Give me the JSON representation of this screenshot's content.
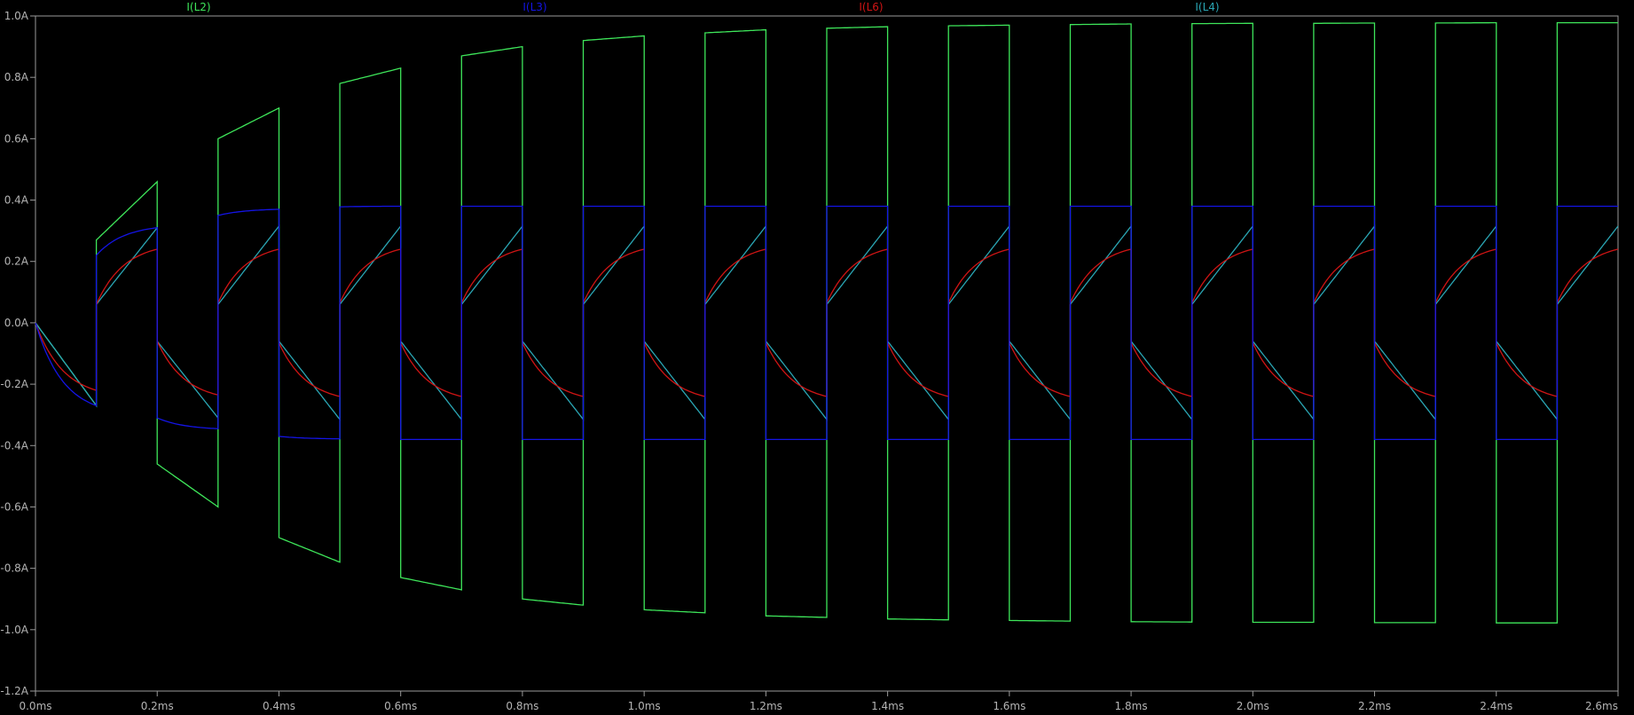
{
  "chart_data": {
    "type": "line",
    "title": "",
    "xlabel": "",
    "ylabel": "",
    "x_unit": "ms",
    "y_unit": "A",
    "xlim": [
      0.0,
      2.6
    ],
    "ylim": [
      -1.2,
      1.0
    ],
    "x_ticks": [
      "0.0ms",
      "0.2ms",
      "0.4ms",
      "0.6ms",
      "0.8ms",
      "1.0ms",
      "1.2ms",
      "1.4ms",
      "1.6ms",
      "1.8ms",
      "2.0ms",
      "2.2ms",
      "2.4ms",
      "2.6ms"
    ],
    "y_ticks": [
      "1.0A",
      "0.8A",
      "0.6A",
      "0.4A",
      "0.2A",
      "0.0A",
      "-0.2A",
      "-0.4A",
      "-0.6A",
      "-0.8A",
      "-1.0A",
      "-1.2A"
    ],
    "grid": false,
    "legend_position": "top",
    "half_period_ms": 0.1,
    "series": [
      {
        "name": "I(L2)",
        "color": "#3ee65a",
        "shape": "square-wave-with-linear-ramps",
        "segments": [
          {
            "t": [
              0.0,
              0.1
            ],
            "start": 0.0,
            "end": -0.27
          },
          {
            "t": [
              0.1,
              0.2
            ],
            "start": 0.27,
            "end": 0.46
          },
          {
            "t": [
              0.2,
              0.3
            ],
            "start": -0.46,
            "end": -0.6
          },
          {
            "t": [
              0.3,
              0.4
            ],
            "start": 0.6,
            "end": 0.7
          },
          {
            "t": [
              0.4,
              0.5
            ],
            "start": -0.7,
            "end": -0.78
          },
          {
            "t": [
              0.5,
              0.6
            ],
            "start": 0.78,
            "end": 0.83
          },
          {
            "t": [
              0.6,
              0.7
            ],
            "start": -0.83,
            "end": -0.87
          },
          {
            "t": [
              0.7,
              0.8
            ],
            "start": 0.87,
            "end": 0.9
          },
          {
            "t": [
              0.8,
              0.9
            ],
            "start": -0.9,
            "end": -0.92
          },
          {
            "t": [
              0.9,
              1.0
            ],
            "start": 0.92,
            "end": 0.935
          },
          {
            "t": [
              1.0,
              1.1
            ],
            "start": -0.935,
            "end": -0.945
          },
          {
            "t": [
              1.1,
              1.2
            ],
            "start": 0.945,
            "end": 0.955
          },
          {
            "t": [
              1.2,
              1.3
            ],
            "start": -0.955,
            "end": -0.96
          },
          {
            "t": [
              1.3,
              1.4
            ],
            "start": 0.96,
            "end": 0.965
          },
          {
            "t": [
              1.4,
              1.5
            ],
            "start": -0.965,
            "end": -0.968
          },
          {
            "t": [
              1.5,
              1.6
            ],
            "start": 0.968,
            "end": 0.97
          },
          {
            "t": [
              1.6,
              1.7
            ],
            "start": -0.97,
            "end": -0.972
          },
          {
            "t": [
              1.7,
              1.8
            ],
            "start": 0.972,
            "end": 0.974
          },
          {
            "t": [
              1.8,
              1.9
            ],
            "start": -0.974,
            "end": -0.975
          },
          {
            "t": [
              1.9,
              2.0
            ],
            "start": 0.975,
            "end": 0.976
          },
          {
            "t": [
              2.0,
              2.1
            ],
            "start": -0.976,
            "end": -0.976
          },
          {
            "t": [
              2.1,
              2.2
            ],
            "start": 0.976,
            "end": 0.977
          },
          {
            "t": [
              2.2,
              2.3
            ],
            "start": -0.977,
            "end": -0.977
          },
          {
            "t": [
              2.3,
              2.4
            ],
            "start": 0.977,
            "end": 0.978
          },
          {
            "t": [
              2.4,
              2.5
            ],
            "start": -0.978,
            "end": -0.978
          },
          {
            "t": [
              2.5,
              2.6
            ],
            "start": 0.978,
            "end": 0.978
          }
        ]
      },
      {
        "name": "I(L3)",
        "color": "#1414e6",
        "shape": "square-wave-with-curved-ramps",
        "segments": [
          {
            "t": [
              0.0,
              0.1
            ],
            "start": 0.0,
            "end": -0.27
          },
          {
            "t": [
              0.1,
              0.2
            ],
            "start": 0.22,
            "end": 0.31
          },
          {
            "t": [
              0.2,
              0.3
            ],
            "start": -0.31,
            "end": -0.345
          },
          {
            "t": [
              0.3,
              0.4
            ],
            "start": 0.35,
            "end": 0.37
          },
          {
            "t": [
              0.4,
              0.5
            ],
            "start": -0.37,
            "end": -0.378
          },
          {
            "t": [
              0.5,
              0.6
            ],
            "start": 0.378,
            "end": 0.38
          },
          {
            "t": [
              0.6,
              0.7
            ],
            "start": -0.38,
            "end": -0.38
          },
          {
            "t": [
              0.7,
              0.8
            ],
            "start": 0.38,
            "end": 0.38
          },
          {
            "t": [
              0.8,
              0.9
            ],
            "start": -0.38,
            "end": -0.38
          },
          {
            "t": [
              0.9,
              1.0
            ],
            "start": 0.38,
            "end": 0.38
          },
          {
            "t": [
              1.0,
              1.1
            ],
            "start": -0.38,
            "end": -0.38
          },
          {
            "t": [
              1.1,
              1.2
            ],
            "start": 0.38,
            "end": 0.38
          },
          {
            "t": [
              1.2,
              1.3
            ],
            "start": -0.38,
            "end": -0.38
          },
          {
            "t": [
              1.3,
              1.4
            ],
            "start": 0.38,
            "end": 0.38
          },
          {
            "t": [
              1.4,
              1.5
            ],
            "start": -0.38,
            "end": -0.38
          },
          {
            "t": [
              1.5,
              1.6
            ],
            "start": 0.38,
            "end": 0.38
          },
          {
            "t": [
              1.6,
              1.7
            ],
            "start": -0.38,
            "end": -0.38
          },
          {
            "t": [
              1.7,
              1.8
            ],
            "start": 0.38,
            "end": 0.38
          },
          {
            "t": [
              1.8,
              1.9
            ],
            "start": -0.38,
            "end": -0.38
          },
          {
            "t": [
              1.9,
              2.0
            ],
            "start": 0.38,
            "end": 0.38
          },
          {
            "t": [
              2.0,
              2.1
            ],
            "start": -0.38,
            "end": -0.38
          },
          {
            "t": [
              2.1,
              2.2
            ],
            "start": 0.38,
            "end": 0.38
          },
          {
            "t": [
              2.2,
              2.3
            ],
            "start": -0.38,
            "end": -0.38
          },
          {
            "t": [
              2.3,
              2.4
            ],
            "start": 0.38,
            "end": 0.38
          },
          {
            "t": [
              2.4,
              2.5
            ],
            "start": -0.38,
            "end": -0.38
          },
          {
            "t": [
              2.5,
              2.6
            ],
            "start": 0.38,
            "end": 0.38
          }
        ]
      },
      {
        "name": "I(L6)",
        "color": "#d01414",
        "shape": "sawtooth-exponential",
        "segments": [
          {
            "t": [
              0.0,
              0.1
            ],
            "start": 0.0,
            "end": -0.22
          },
          {
            "t": [
              0.1,
              0.2
            ],
            "start": 0.06,
            "end": 0.24
          },
          {
            "t": [
              0.2,
              0.3
            ],
            "start": -0.06,
            "end": -0.235
          },
          {
            "t": [
              0.3,
              0.4
            ],
            "start": 0.065,
            "end": 0.24
          },
          {
            "t": [
              0.4,
              0.5
            ],
            "start": -0.065,
            "end": -0.24
          },
          {
            "t": [
              0.5,
              0.6
            ],
            "start": 0.065,
            "end": 0.24
          },
          {
            "t": [
              0.6,
              0.7
            ],
            "start": -0.065,
            "end": -0.24
          },
          {
            "t": [
              0.7,
              0.8
            ],
            "start": 0.065,
            "end": 0.24
          },
          {
            "t": [
              0.8,
              0.9
            ],
            "start": -0.065,
            "end": -0.24
          },
          {
            "t": [
              0.9,
              1.0
            ],
            "start": 0.065,
            "end": 0.24
          },
          {
            "t": [
              1.0,
              1.1
            ],
            "start": -0.065,
            "end": -0.24
          },
          {
            "t": [
              1.1,
              1.2
            ],
            "start": 0.065,
            "end": 0.24
          },
          {
            "t": [
              1.2,
              1.3
            ],
            "start": -0.065,
            "end": -0.24
          },
          {
            "t": [
              1.3,
              1.4
            ],
            "start": 0.065,
            "end": 0.24
          },
          {
            "t": [
              1.4,
              1.5
            ],
            "start": -0.065,
            "end": -0.24
          },
          {
            "t": [
              1.5,
              1.6
            ],
            "start": 0.065,
            "end": 0.24
          },
          {
            "t": [
              1.6,
              1.7
            ],
            "start": -0.065,
            "end": -0.24
          },
          {
            "t": [
              1.7,
              1.8
            ],
            "start": 0.065,
            "end": 0.24
          },
          {
            "t": [
              1.8,
              1.9
            ],
            "start": -0.065,
            "end": -0.24
          },
          {
            "t": [
              1.9,
              2.0
            ],
            "start": 0.065,
            "end": 0.24
          },
          {
            "t": [
              2.0,
              2.1
            ],
            "start": -0.065,
            "end": -0.24
          },
          {
            "t": [
              2.1,
              2.2
            ],
            "start": 0.065,
            "end": 0.24
          },
          {
            "t": [
              2.2,
              2.3
            ],
            "start": -0.065,
            "end": -0.24
          },
          {
            "t": [
              2.3,
              2.4
            ],
            "start": 0.065,
            "end": 0.24
          },
          {
            "t": [
              2.4,
              2.5
            ],
            "start": -0.065,
            "end": -0.24
          },
          {
            "t": [
              2.5,
              2.6
            ],
            "start": 0.065,
            "end": 0.24
          }
        ]
      },
      {
        "name": "I(L4)",
        "color": "#2aa6b4",
        "shape": "sawtooth-linear",
        "segments": [
          {
            "t": [
              0.0,
              0.1
            ],
            "start": 0.0,
            "end": -0.27
          },
          {
            "t": [
              0.1,
              0.2
            ],
            "start": 0.06,
            "end": 0.31
          },
          {
            "t": [
              0.2,
              0.3
            ],
            "start": -0.06,
            "end": -0.31
          },
          {
            "t": [
              0.3,
              0.4
            ],
            "start": 0.06,
            "end": 0.315
          },
          {
            "t": [
              0.4,
              0.5
            ],
            "start": -0.06,
            "end": -0.315
          },
          {
            "t": [
              0.5,
              0.6
            ],
            "start": 0.06,
            "end": 0.315
          },
          {
            "t": [
              0.6,
              0.7
            ],
            "start": -0.06,
            "end": -0.315
          },
          {
            "t": [
              0.7,
              0.8
            ],
            "start": 0.06,
            "end": 0.315
          },
          {
            "t": [
              0.8,
              0.9
            ],
            "start": -0.06,
            "end": -0.315
          },
          {
            "t": [
              0.9,
              1.0
            ],
            "start": 0.06,
            "end": 0.315
          },
          {
            "t": [
              1.0,
              1.1
            ],
            "start": -0.06,
            "end": -0.315
          },
          {
            "t": [
              1.1,
              1.2
            ],
            "start": 0.06,
            "end": 0.315
          },
          {
            "t": [
              1.2,
              1.3
            ],
            "start": -0.06,
            "end": -0.315
          },
          {
            "t": [
              1.3,
              1.4
            ],
            "start": 0.06,
            "end": 0.315
          },
          {
            "t": [
              1.4,
              1.5
            ],
            "start": -0.06,
            "end": -0.315
          },
          {
            "t": [
              1.5,
              1.6
            ],
            "start": 0.06,
            "end": 0.315
          },
          {
            "t": [
              1.6,
              1.7
            ],
            "start": -0.06,
            "end": -0.315
          },
          {
            "t": [
              1.7,
              1.8
            ],
            "start": 0.06,
            "end": 0.315
          },
          {
            "t": [
              1.8,
              1.9
            ],
            "start": -0.06,
            "end": -0.315
          },
          {
            "t": [
              1.9,
              2.0
            ],
            "start": 0.06,
            "end": 0.315
          },
          {
            "t": [
              2.0,
              2.1
            ],
            "start": -0.06,
            "end": -0.315
          },
          {
            "t": [
              2.1,
              2.2
            ],
            "start": 0.06,
            "end": 0.315
          },
          {
            "t": [
              2.2,
              2.3
            ],
            "start": -0.06,
            "end": -0.315
          },
          {
            "t": [
              2.3,
              2.4
            ],
            "start": 0.06,
            "end": 0.315
          },
          {
            "t": [
              2.4,
              2.5
            ],
            "start": -0.06,
            "end": -0.315
          },
          {
            "t": [
              2.5,
              2.6
            ],
            "start": 0.06,
            "end": 0.315
          }
        ]
      }
    ]
  }
}
